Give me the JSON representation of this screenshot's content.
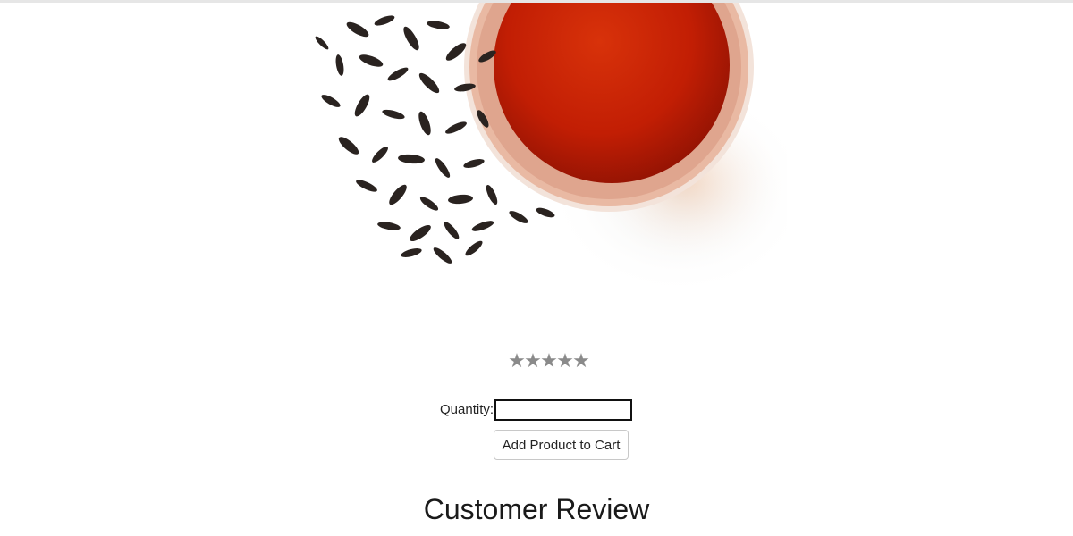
{
  "product": {
    "image_alt": "loose leaf black tea beside a cup of brewed tea",
    "rating": 5,
    "rating_max": 5,
    "star_color": "#8a8a8a"
  },
  "purchase": {
    "quantity_label": "Quantity:",
    "quantity_value": "",
    "add_to_cart_label": "Add Product to Cart"
  },
  "reviews": {
    "heading": "Customer Review"
  },
  "colors": {
    "tea": "#c21e04",
    "tea_dark": "#8e1203",
    "leaf": "#2a2320"
  }
}
